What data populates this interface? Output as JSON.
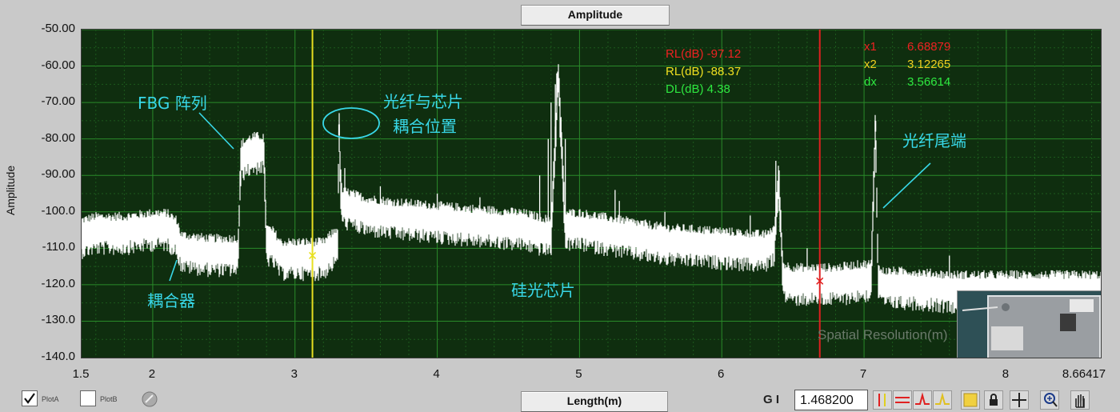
{
  "title": "Amplitude",
  "xlabel_text": "Length(m)",
  "chart_data": {
    "type": "line",
    "title": "Amplitude",
    "xlabel": "Length(m)",
    "ylabel": "Amplitude",
    "xlim": [
      1.5,
      8.66417
    ],
    "ylim": [
      -140,
      -50
    ],
    "x_ticks": [
      "1.5",
      "2",
      "3",
      "4",
      "5",
      "6",
      "7",
      "8",
      "8.66417"
    ],
    "y_ticks": [
      "-50.00",
      "-60.00",
      "-70.00",
      "-80.00",
      "-90.00",
      "-100.0",
      "-110.0",
      "-120.0",
      "-130.0",
      "-140.0"
    ],
    "grid": true,
    "series": [
      {
        "name": "PlotA",
        "color": "#ffffff",
        "x": [
          1.5,
          1.6,
          1.8,
          2.0,
          2.1,
          2.17,
          2.2,
          2.4,
          2.6,
          2.62,
          2.7,
          2.78,
          2.8,
          2.85,
          2.9,
          3.0,
          3.1,
          3.2,
          3.3,
          3.31,
          3.32,
          3.33,
          3.35,
          3.5,
          3.7,
          4.0,
          4.3,
          4.6,
          4.8,
          4.85,
          4.9,
          5.0,
          5.3,
          5.6,
          6.0,
          6.3,
          6.37,
          6.4,
          6.43,
          6.5,
          6.8,
          7.0,
          7.05,
          7.08,
          7.1,
          7.13,
          7.3,
          7.6,
          8.0,
          8.3,
          8.66
        ],
        "y": [
          -106,
          -105,
          -105,
          -104,
          -104,
          -106,
          -110,
          -111,
          -111,
          -85,
          -83,
          -83,
          -108,
          -109,
          -112,
          -112,
          -112,
          -112,
          -108,
          -76,
          -92,
          -98,
          -98,
          -100,
          -101,
          -102,
          -103,
          -104,
          -106,
          -62,
          -104,
          -104,
          -106,
          -108,
          -109,
          -110,
          -108,
          -90,
          -118,
          -119,
          -119,
          -118,
          -118,
          -75,
          -119,
          -120,
          -120,
          -121,
          -121,
          -121,
          -121
        ]
      }
    ],
    "cursors": [
      {
        "name": "x1",
        "x": 6.68879,
        "color": "#e02020"
      },
      {
        "name": "x2",
        "x": 3.12265,
        "color": "#e8e020"
      }
    ],
    "readouts": [
      {
        "label": "RL(dB) -97.12",
        "color": "#ee2222"
      },
      {
        "label": "RL(dB) -88.37",
        "color": "#f0e020"
      },
      {
        "label": "DL(dB)   4.38",
        "color": "#2ee840"
      }
    ],
    "cursor_values": [
      {
        "name": "x1",
        "value": "6.68879",
        "color": "#ee2222"
      },
      {
        "name": "x2",
        "value": "3.12265",
        "color": "#f0d020"
      },
      {
        "name": "dx",
        "value": "3.56614",
        "color": "#2ee840"
      }
    ],
    "annotations": [
      {
        "text": "FBG 阵列"
      },
      {
        "text": "耦合器"
      },
      {
        "text": "光纤与芯片"
      },
      {
        "text": "耦合位置"
      },
      {
        "text": "硅光芯片"
      },
      {
        "text": "光纤尾端"
      }
    ],
    "watermark": "Spatial Resolution(m)"
  },
  "legend": [
    {
      "label": "PlotA",
      "checked": true
    },
    {
      "label": "PlotB",
      "checked": false
    }
  ],
  "gain_label": "G I",
  "gain_value": "1.468200",
  "annotation_color": "#38d8e8",
  "grid_color": "#2a8a2a",
  "plot_bg": "#0f2e0f"
}
